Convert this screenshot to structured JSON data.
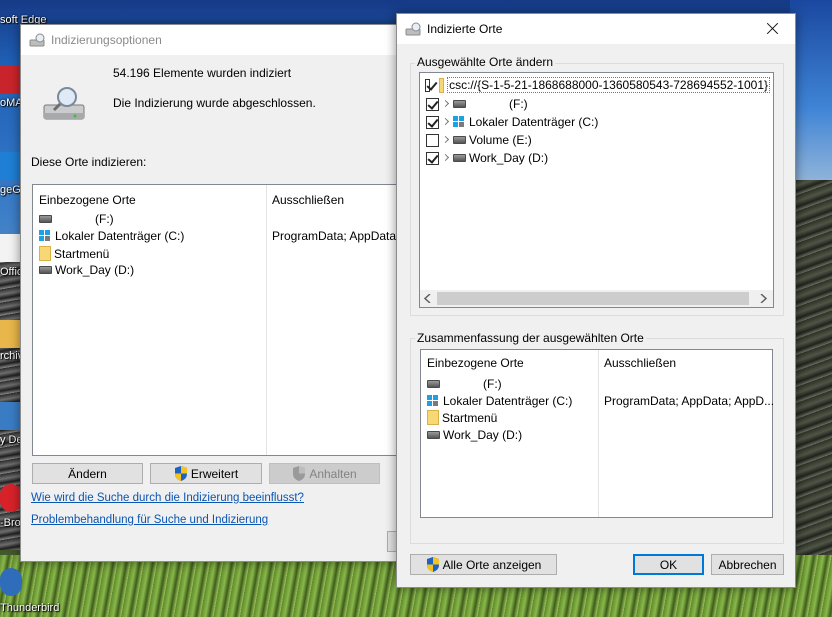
{
  "desktop": {
    "icons": [
      {
        "label": "soft Edge"
      },
      {
        "label": "oMA"
      },
      {
        "label": "geG"
      },
      {
        "label": "Offic"
      },
      {
        "label": "rchiv"
      },
      {
        "label": "y De"
      },
      {
        "label": "-Bro"
      },
      {
        "label": "Thunderbird"
      }
    ]
  },
  "indexing_window": {
    "title": "Indizierungsoptionen",
    "count_text": "54.196 Elemente wurden indiziert",
    "status_text": "Die Indizierung wurde abgeschlossen.",
    "section_label": "Diese Orte indizieren:",
    "columns": {
      "included": "Einbezogene Orte",
      "excluded": "Ausschließen"
    },
    "rows": [
      {
        "label": "(F:)",
        "icon": "drive-icon",
        "excluded": ""
      },
      {
        "label": "Lokaler Datenträger (C:)",
        "icon": "windows-drive-icon",
        "excluded": "ProgramData; AppData; A"
      },
      {
        "label": "Startmenü",
        "icon": "folder-icon",
        "excluded": ""
      },
      {
        "label": "Work_Day (D:)",
        "icon": "drive-icon",
        "excluded": ""
      }
    ],
    "buttons": {
      "modify": "Ändern",
      "advanced": "Erweitert",
      "pause": "Anhalten"
    },
    "links": {
      "how_search": "Wie wird die Suche durch die Indizierung beeinflusst?",
      "troubleshoot": "Problembehandlung für Suche und Indizierung"
    }
  },
  "locations_dialog": {
    "title": "Indizierte Orte",
    "change_group_label": "Ausgewählte Orte ändern",
    "tree": [
      {
        "label": "csc://{S-1-5-21-1868688000-1360580543-728694552-1001}",
        "checked": true,
        "expander": false,
        "icon": "folder-icon"
      },
      {
        "label": "(F:)",
        "checked": true,
        "expander": true,
        "icon": "drive-icon"
      },
      {
        "label": "Lokaler Datenträger (C:)",
        "checked": true,
        "expander": true,
        "icon": "windows-drive-icon"
      },
      {
        "label": "Volume (E:)",
        "checked": false,
        "expander": true,
        "icon": "drive-icon"
      },
      {
        "label": "Work_Day (D:)",
        "checked": true,
        "expander": true,
        "icon": "drive-icon"
      }
    ],
    "summary_group_label": "Zusammenfassung der ausgewählten Orte",
    "summary_columns": {
      "included": "Einbezogene Orte",
      "excluded": "Ausschließen"
    },
    "summary_rows": [
      {
        "label": "(F:)",
        "icon": "drive-icon",
        "excluded": ""
      },
      {
        "label": "Lokaler Datenträger (C:)",
        "icon": "windows-drive-icon",
        "excluded": "ProgramData; AppData; AppD..."
      },
      {
        "label": "Startmenü",
        "icon": "folder-icon",
        "excluded": ""
      },
      {
        "label": "Work_Day (D:)",
        "icon": "drive-icon",
        "excluded": ""
      }
    ],
    "buttons": {
      "show_all": "Alle Orte anzeigen",
      "ok": "OK",
      "cancel": "Abbrechen"
    }
  },
  "colors": {
    "accent": "#0078d7",
    "link": "#0b55b3",
    "window_bg": "#f0f0f0",
    "folder": "#f8d775"
  }
}
